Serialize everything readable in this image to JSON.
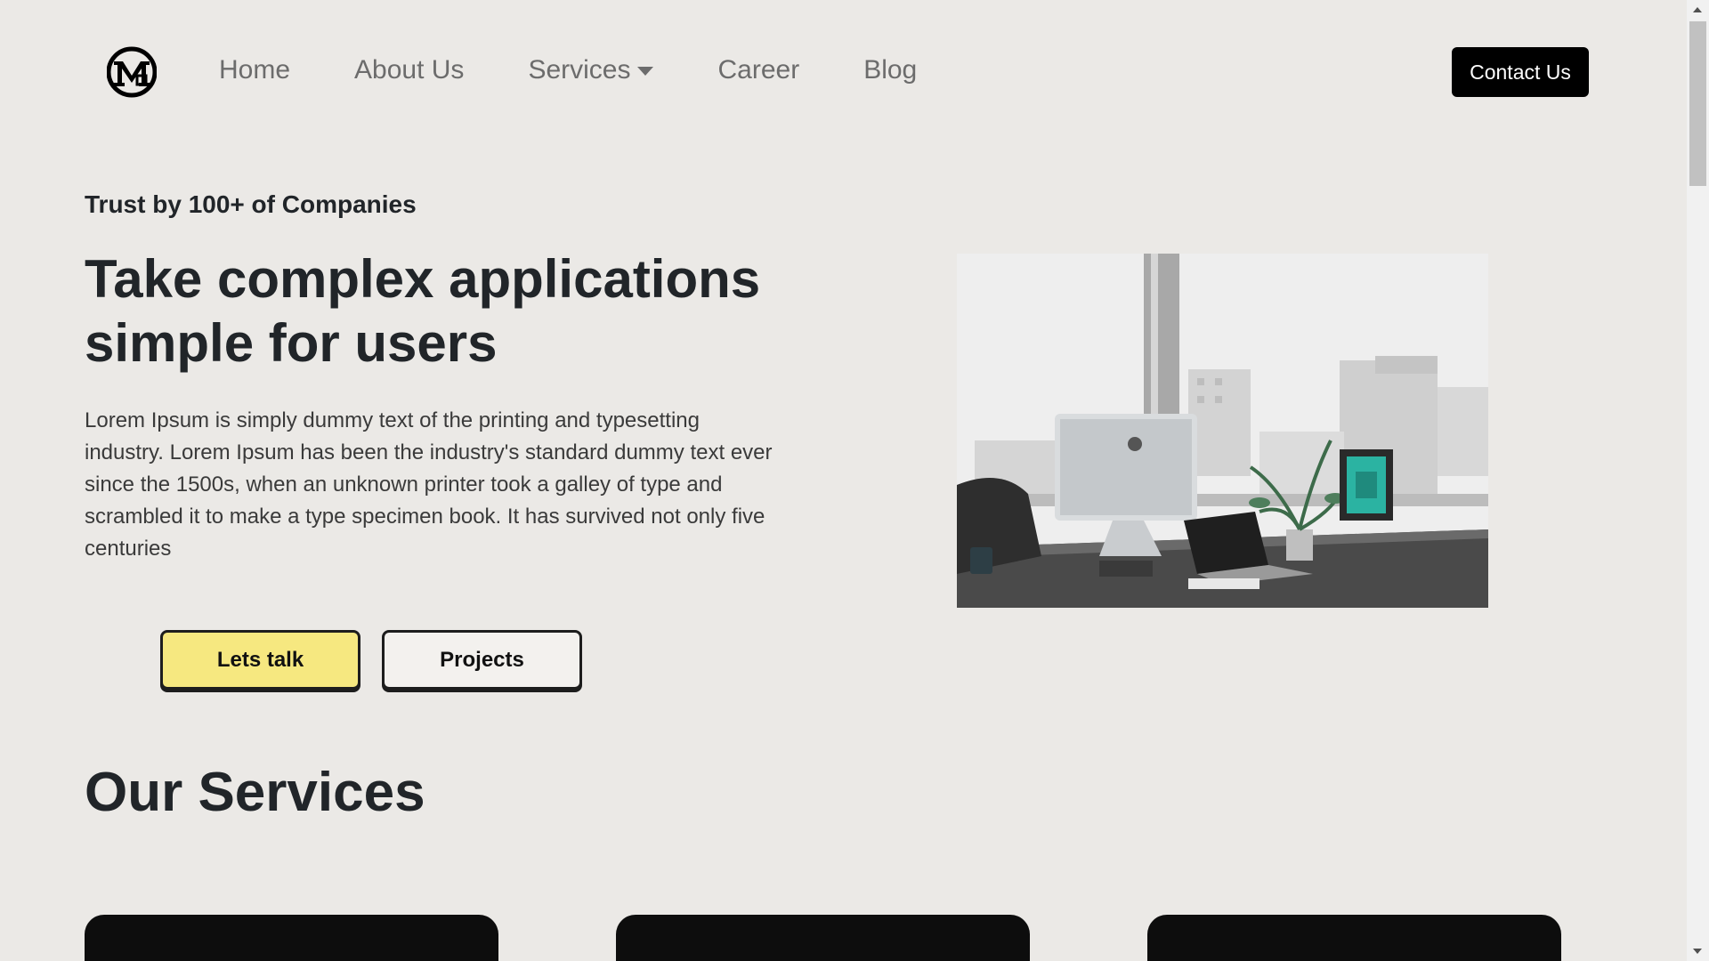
{
  "nav": {
    "logo_alt": "MG logo",
    "items": [
      {
        "label": "Home"
      },
      {
        "label": "About Us"
      },
      {
        "label": "Services",
        "has_dropdown": true
      },
      {
        "label": "Career"
      },
      {
        "label": "Blog"
      }
    ],
    "contact_label": "Contact Us"
  },
  "hero": {
    "trust_text": "Trust by 100+ of Companies",
    "title": "Take complex applications simple for users",
    "description": "Lorem Ipsum is simply dummy text of the printing and typesetting industry. Lorem Ipsum has been the industry's standard dummy text ever since the 1500s, when an unknown printer took a galley of type and scrambled it to make a type specimen book. It has survived not only five centuries",
    "primary_button": "Lets talk",
    "secondary_button": "Projects",
    "image_desc": "office-desk-photo"
  },
  "services": {
    "title": "Our Services",
    "cards": [
      {},
      {},
      {}
    ]
  },
  "colors": {
    "background": "#ebe9e6",
    "accent_yellow": "#f6e880",
    "dark": "#0d0d0d"
  }
}
